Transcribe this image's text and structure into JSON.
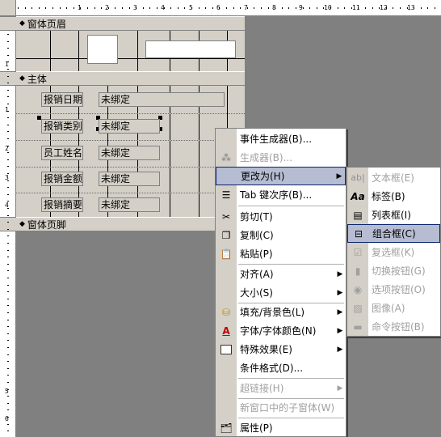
{
  "ruler": {
    "h_numbers": [
      "1",
      "2",
      "3",
      "4",
      "5",
      "6",
      "7",
      "8",
      "9",
      "10",
      "11",
      "12",
      "13"
    ],
    "v_numbers": [
      "1",
      "1",
      "2",
      "3",
      "4",
      "5",
      "6"
    ]
  },
  "sections": {
    "header": "窗体页眉",
    "detail": "主体",
    "footer": "窗体页脚"
  },
  "fields": [
    {
      "label": "报销日期",
      "control": "未绑定"
    },
    {
      "label": "报销类别",
      "control": "未绑定"
    },
    {
      "label": "员工姓名",
      "control": "未绑定"
    },
    {
      "label": "报销金额",
      "control": "未绑定"
    },
    {
      "label": "报销摘要",
      "control": "未绑定"
    }
  ],
  "context_menu": {
    "items": [
      {
        "label": "事件生成器(B)...",
        "icon": "none",
        "disabled": false
      },
      {
        "label": "生成器(B)...",
        "icon": "builder-wand-icon",
        "disabled": true
      },
      {
        "label": "更改为(H)",
        "icon": "none",
        "disabled": false,
        "submenu": true,
        "highlighted": true
      },
      {
        "label": "Tab 键次序(B)...",
        "icon": "tab-order-icon",
        "disabled": false
      },
      {
        "label": "剪切(T)",
        "icon": "scissors-icon",
        "disabled": false
      },
      {
        "label": "复制(C)",
        "icon": "copy-icon",
        "disabled": false
      },
      {
        "label": "粘贴(P)",
        "icon": "paste-icon",
        "disabled": false
      },
      {
        "label": "对齐(A)",
        "icon": "none",
        "disabled": false,
        "submenu": true
      },
      {
        "label": "大小(S)",
        "icon": "none",
        "disabled": false,
        "submenu": true
      },
      {
        "label": "填充/背景色(L)",
        "icon": "fill-bucket-icon",
        "disabled": false,
        "submenu": true
      },
      {
        "label": "字体/字体颜色(N)",
        "icon": "font-color-icon",
        "disabled": false,
        "submenu": true
      },
      {
        "label": "特殊效果(E)",
        "icon": "special-effect-icon",
        "disabled": false,
        "submenu": true
      },
      {
        "label": "条件格式(D)...",
        "icon": "none",
        "disabled": false
      },
      {
        "label": "超链接(H)",
        "icon": "none",
        "disabled": true,
        "submenu": true
      },
      {
        "label": "新窗口中的子窗体(W)",
        "icon": "none",
        "disabled": true
      },
      {
        "label": "属性(P)",
        "icon": "properties-icon",
        "disabled": false
      }
    ]
  },
  "change_to_menu": {
    "items": [
      {
        "label": "文本框(E)",
        "icon": "textbox-icon",
        "disabled": true
      },
      {
        "label": "标签(B)",
        "icon": "label-icon",
        "disabled": false
      },
      {
        "label": "列表框(I)",
        "icon": "listbox-icon",
        "disabled": false
      },
      {
        "label": "组合框(C)",
        "icon": "combobox-icon",
        "disabled": false,
        "highlighted": true
      },
      {
        "label": "复选框(K)",
        "icon": "checkbox-icon",
        "disabled": true
      },
      {
        "label": "切换按钮(G)",
        "icon": "toggle-button-icon",
        "disabled": true
      },
      {
        "label": "选项按钮(O)",
        "icon": "option-button-icon",
        "disabled": true
      },
      {
        "label": "图像(A)",
        "icon": "image-icon",
        "disabled": true
      },
      {
        "label": "命令按钮(B)",
        "icon": "command-button-icon",
        "disabled": true
      }
    ]
  },
  "colors": {
    "workspace": "#808080",
    "section_bg": "#d4d0c8",
    "highlight": "#d8e0f0",
    "highlight_border": "#0a246a",
    "disabled_text": "#a0a0a0"
  }
}
